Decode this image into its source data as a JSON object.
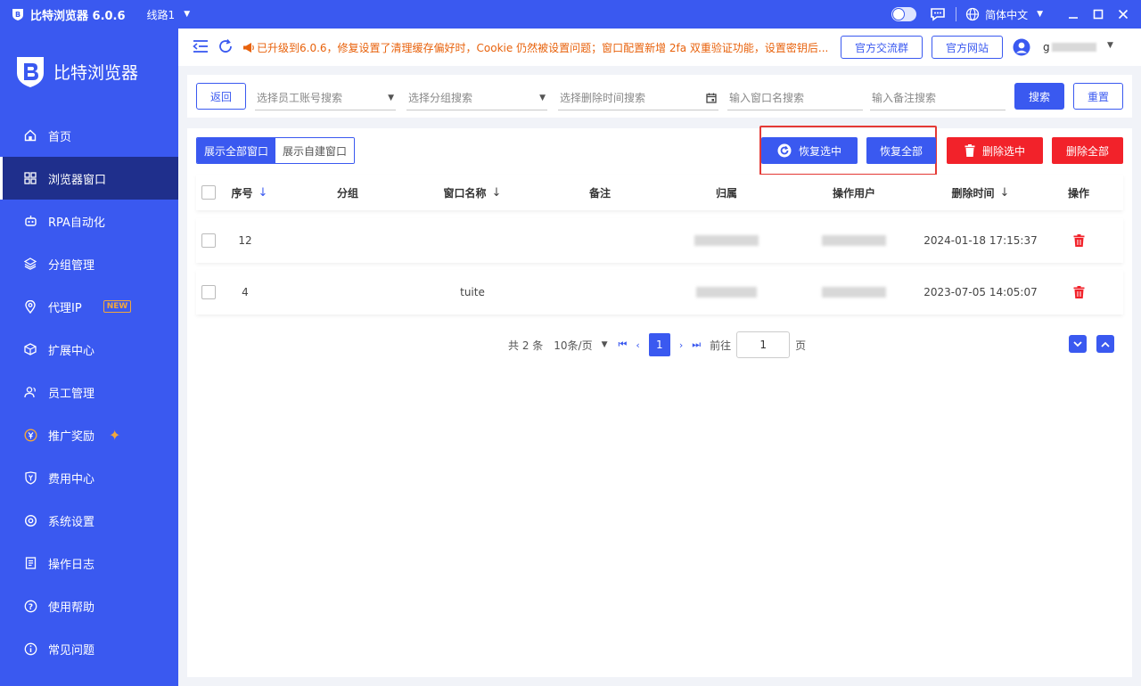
{
  "titlebar": {
    "title": "比特浏览器 6.0.6",
    "line": "线路1",
    "language": "简体中文"
  },
  "sidebar": {
    "brand": "比特浏览器",
    "items": [
      {
        "label": "首页",
        "icon": "home-icon"
      },
      {
        "label": "浏览器窗口",
        "icon": "grid-icon",
        "active": true
      },
      {
        "label": "RPA自动化",
        "icon": "robot-icon"
      },
      {
        "label": "分组管理",
        "icon": "layers-icon"
      },
      {
        "label": "代理IP",
        "icon": "location-icon",
        "badge": "NEW"
      },
      {
        "label": "扩展中心",
        "icon": "cube-icon"
      },
      {
        "label": "员工管理",
        "icon": "users-icon"
      },
      {
        "label": "推广奖励",
        "icon": "yen-icon"
      },
      {
        "label": "费用中心",
        "icon": "shield-yen-icon"
      },
      {
        "label": "系统设置",
        "icon": "gear-icon"
      },
      {
        "label": "操作日志",
        "icon": "log-icon"
      },
      {
        "label": "使用帮助",
        "icon": "help-icon"
      },
      {
        "label": "常见问题",
        "icon": "info-icon"
      }
    ]
  },
  "topbar": {
    "notice": "已升级到6.0.6，修复设置了清理缓存偏好时，Cookie 仍然被设置问题；窗口配置新增 2fa 双重验证功能，设置密钥后...",
    "group_btn": "官方交流群",
    "site_btn": "官方网站",
    "username": "g"
  },
  "search": {
    "back": "返回",
    "employee_placeholder": "选择员工账号搜索",
    "group_placeholder": "选择分组搜索",
    "time_placeholder": "选择删除时间搜索",
    "window_placeholder": "输入窗口名搜索",
    "remark_placeholder": "输入备注搜索",
    "search_btn": "搜索",
    "reset_btn": "重置"
  },
  "toolbar": {
    "show_all": "展示全部窗口",
    "show_own": "展示自建窗口",
    "restore_selected": "恢复选中",
    "restore_all": "恢复全部",
    "delete_selected": "删除选中",
    "delete_all": "删除全部"
  },
  "table": {
    "headers": {
      "seq": "序号",
      "group": "分组",
      "name": "窗口名称",
      "remark": "备注",
      "owner": "归属",
      "user": "操作用户",
      "deleted_at": "删除时间",
      "action": "操作"
    },
    "rows": [
      {
        "seq": "12",
        "group": "",
        "name": "",
        "remark": "",
        "deleted_at": "2024-01-18 17:15:37"
      },
      {
        "seq": "4",
        "group": "",
        "name": "tuite",
        "remark": "",
        "deleted_at": "2023-07-05 14:05:07"
      }
    ]
  },
  "pager": {
    "total": "共 2 条",
    "page_size": "10条/页",
    "current": "1",
    "goto_label": "前往",
    "goto_value": "1",
    "page_suffix": "页"
  },
  "colors": {
    "primary": "#3a59f0",
    "danger": "#f2222a",
    "notice": "#e8620c",
    "highlight": "#e53935"
  }
}
